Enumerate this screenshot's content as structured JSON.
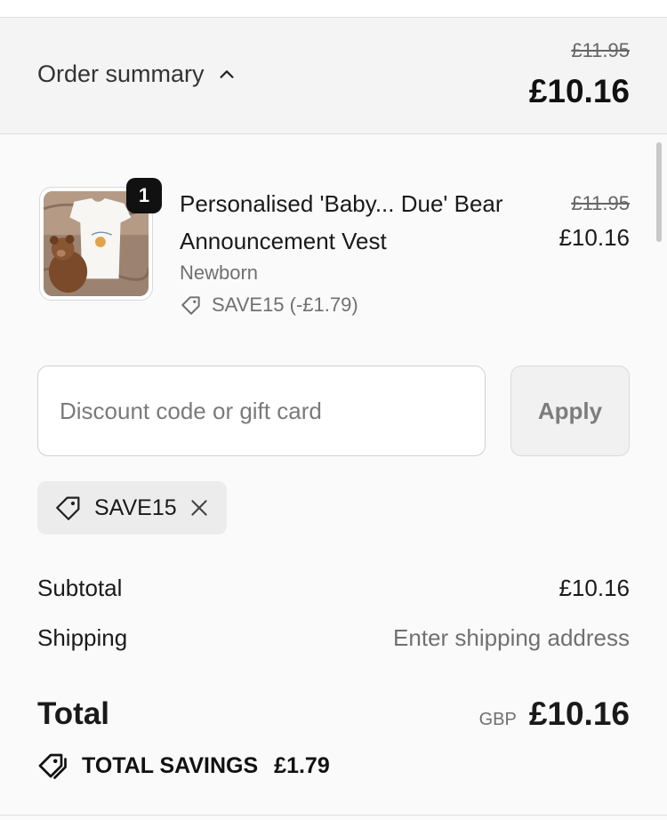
{
  "summary": {
    "toggle_label": "Order summary",
    "original_total": "£11.95",
    "total": "£10.16"
  },
  "line_item": {
    "quantity": "1",
    "title": "Personalised 'Baby... Due' Bear Announcement Vest",
    "variant": "Newborn",
    "discount": "SAVE15 (-£1.79)",
    "original_price": "£11.95",
    "price": "£10.16",
    "thumbnail_icon": "baby-vest-with-teddy-bear-image"
  },
  "discount_form": {
    "placeholder": "Discount code or gift card",
    "value": "",
    "apply_label": "Apply"
  },
  "applied_code": {
    "label": "SAVE15"
  },
  "totals": {
    "subtotal_label": "Subtotal",
    "subtotal_value": "£10.16",
    "shipping_label": "Shipping",
    "shipping_value": "Enter shipping address",
    "total_label": "Total",
    "currency": "GBP",
    "total_value": "£10.16",
    "savings_label": "TOTAL SAVINGS",
    "savings_value": "£1.79"
  },
  "colors": {
    "summary_bg": "#f4f4f4",
    "page_bg": "#fafafa",
    "badge_bg": "#111111"
  }
}
